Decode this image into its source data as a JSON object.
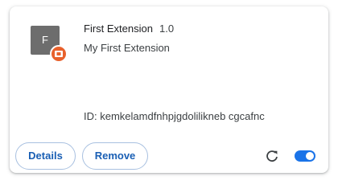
{
  "extension": {
    "icon_letter": "F",
    "name": "First Extension",
    "version": "1.0",
    "description": "My First Extension",
    "id_text": "ID: kemkelamdfnhpjgdolilikneb cgcafnc",
    "enabled": true
  },
  "buttons": {
    "details": "Details",
    "remove": "Remove"
  },
  "icons": {
    "badge": "unpacked-source-badge-icon",
    "reload": "reload-icon"
  },
  "colors": {
    "accent": "#1a73e8",
    "button_text": "#1a5fb4",
    "badge": "#e8612c",
    "icon_bg": "#6d6d6d"
  }
}
